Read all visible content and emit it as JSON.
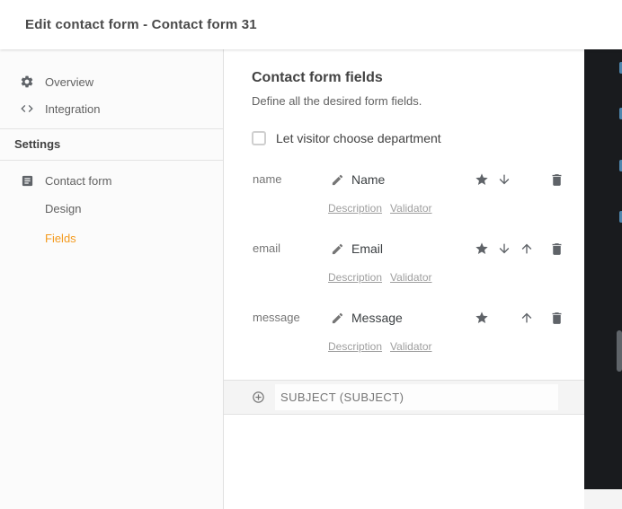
{
  "dialog": {
    "title": "Edit contact form - Contact form 31"
  },
  "sidebar": {
    "nav_items": [
      {
        "id": "overview",
        "label": "Overview",
        "icon": "gear-icon"
      },
      {
        "id": "integration",
        "label": "Integration",
        "icon": "code-icon"
      }
    ],
    "section_title": "Settings",
    "settings_items": [
      {
        "id": "contact-form",
        "label": "Contact form",
        "icon": "form-icon",
        "active": false
      },
      {
        "id": "design",
        "label": "Design",
        "icon": null,
        "active": false
      },
      {
        "id": "fields",
        "label": "Fields",
        "icon": null,
        "active": true
      }
    ]
  },
  "content": {
    "title": "Contact form fields",
    "subtitle": "Define all the desired form fields.",
    "checkbox": {
      "label": "Let visitor choose department",
      "checked": false
    },
    "link_labels": {
      "description": "Description",
      "validator": "Validator"
    },
    "fields": [
      {
        "key": "name",
        "label": "Name",
        "actions": [
          "star",
          "move-down",
          null,
          "delete"
        ]
      },
      {
        "key": "email",
        "label": "Email",
        "actions": [
          "star",
          "move-down",
          "move-up",
          "delete"
        ]
      },
      {
        "key": "message",
        "label": "Message",
        "actions": [
          "star",
          null,
          "move-up",
          "delete"
        ]
      }
    ],
    "add_field": {
      "label": "SUBJECT (SUBJECT)"
    }
  },
  "colors": {
    "accent": "#F49B1F",
    "dark_panel": "#191B1E",
    "icon_gray": "#5F6368"
  }
}
